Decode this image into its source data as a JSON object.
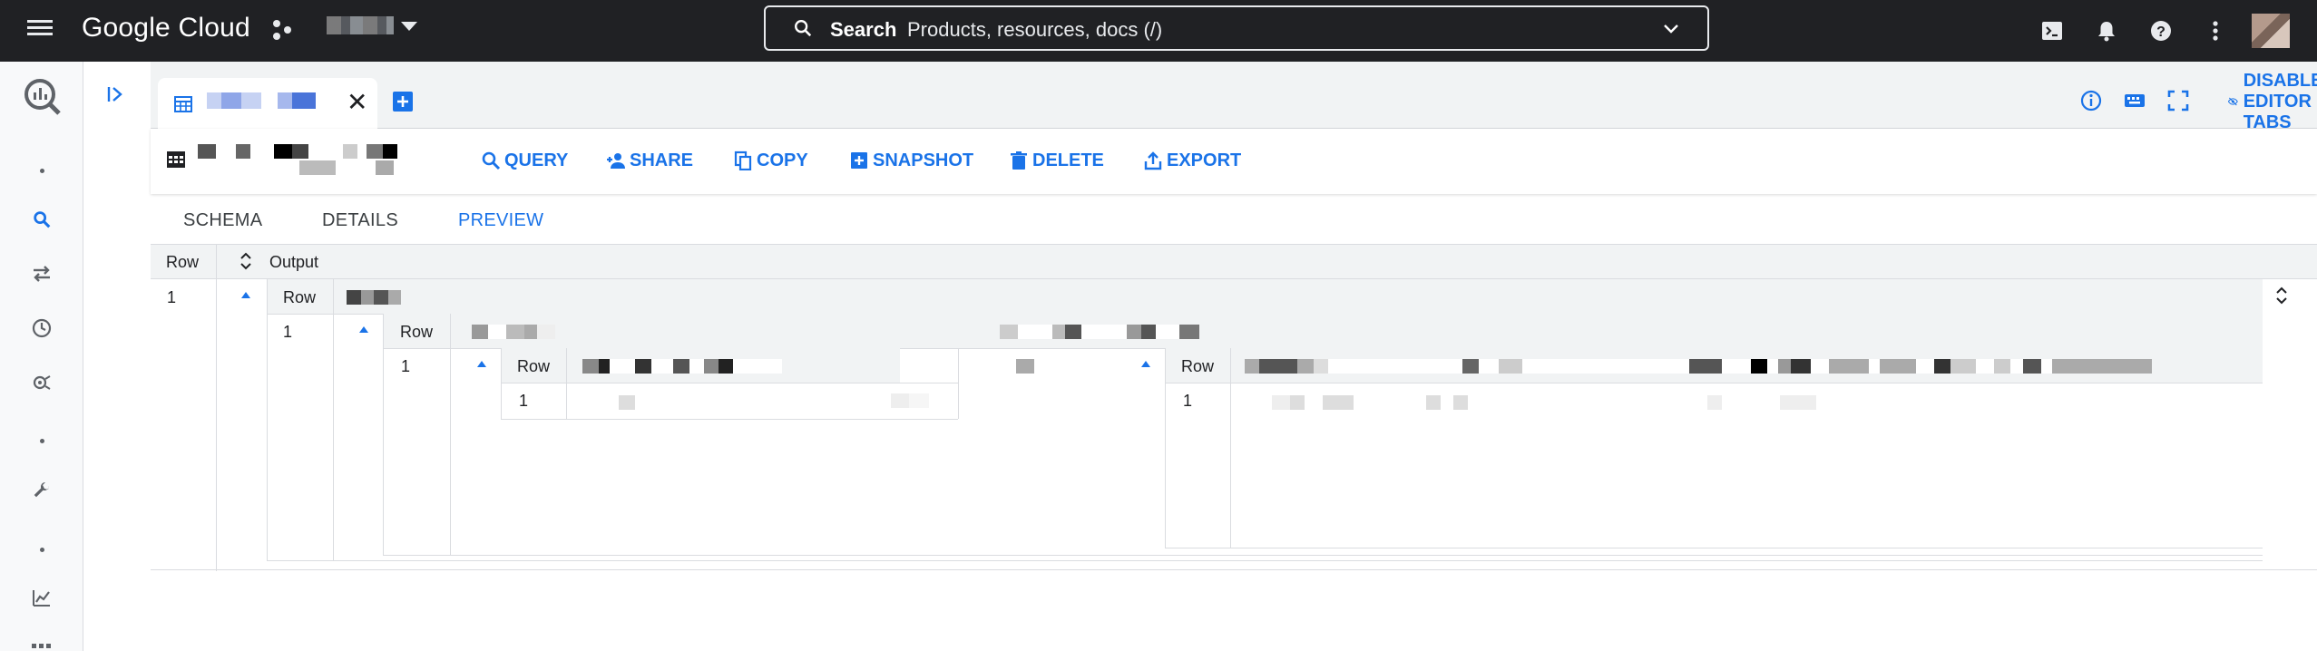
{
  "topbar": {
    "logo": "Google Cloud",
    "search_label": "Search",
    "search_placeholder": "Products, resources, docs (/)"
  },
  "tabstrip": {
    "disable_editor_tabs": "DISABLE EDITOR TABS"
  },
  "toolbar": {
    "query": "QUERY",
    "share": "SHARE",
    "copy": "COPY",
    "snapshot": "SNAPSHOT",
    "delete": "DELETE",
    "export": "EXPORT"
  },
  "subtabs": {
    "schema": "SCHEMA",
    "details": "DETAILS",
    "preview": "PREVIEW"
  },
  "grid": {
    "header_row": "Row",
    "header_output": "Output",
    "row_number": "1",
    "nested_row_label": "Row",
    "level2_row": "1",
    "level2_row_label": "Row",
    "level3_row": "1",
    "level3_row_label": "Row",
    "level4_row": "1",
    "right_row_label": "Row",
    "right_row": "1"
  },
  "colors": {
    "accent": "#1a73e8",
    "topbar": "#202124",
    "border": "#dadce0"
  }
}
